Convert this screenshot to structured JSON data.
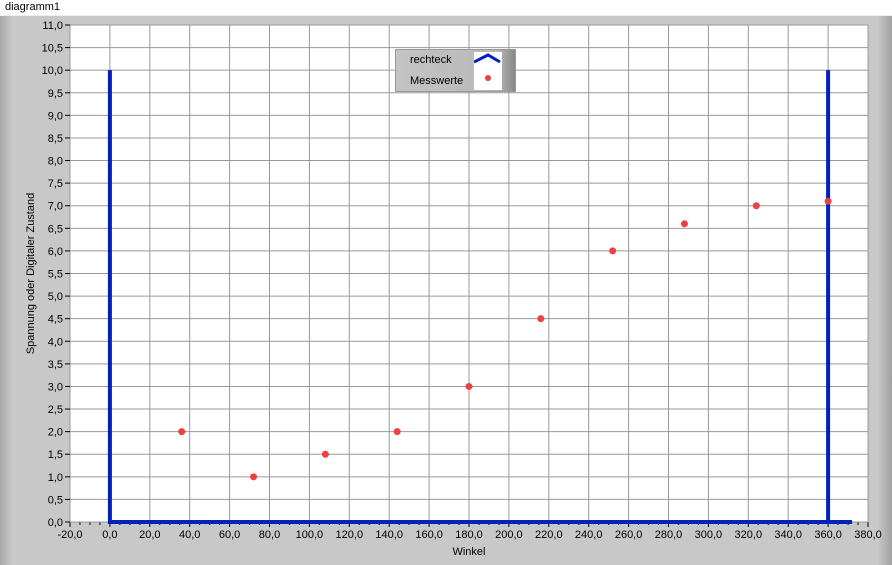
{
  "title": "diagramm1",
  "chart_data": {
    "type": "scatter",
    "title": "diagramm1",
    "xlabel": "Winkel",
    "ylabel": "Spannung oder Digitaler Zustand",
    "xlim": [
      -20,
      380
    ],
    "ylim": [
      0,
      11
    ],
    "xticks": [
      "-20,0",
      "0,0",
      "20,0",
      "40,0",
      "60,0",
      "80,0",
      "100,0",
      "120,0",
      "140,0",
      "160,0",
      "180,0",
      "200,0",
      "220,0",
      "240,0",
      "260,0",
      "280,0",
      "300,0",
      "320,0",
      "340,0",
      "360,0",
      "380,0"
    ],
    "yticks": [
      "0,0",
      "0,5",
      "1,0",
      "1,5",
      "2,0",
      "2,5",
      "3,0",
      "3,5",
      "4,0",
      "4,5",
      "5,0",
      "5,5",
      "6,0",
      "6,5",
      "7,0",
      "7,5",
      "8,0",
      "8,5",
      "9,0",
      "9,5",
      "10,0",
      "10,5",
      "11,0"
    ],
    "grid": true,
    "legend_position": "top-center",
    "series": [
      {
        "name": "rechteck",
        "type": "line",
        "color": "#0020c0",
        "x": [
          0,
          0,
          0,
          360,
          360,
          360,
          372
        ],
        "y": [
          0,
          10,
          0,
          0,
          10,
          0,
          0
        ]
      },
      {
        "name": "Messwerte",
        "type": "scatter",
        "color": "#f04040",
        "x": [
          36,
          72,
          108,
          144,
          180,
          216,
          252,
          288,
          324,
          360
        ],
        "y": [
          2,
          1,
          1.5,
          2,
          3,
          4.5,
          6,
          6.6,
          7,
          7.1
        ]
      }
    ]
  }
}
